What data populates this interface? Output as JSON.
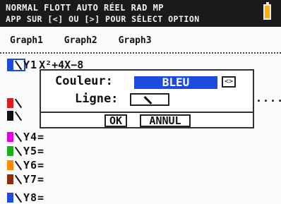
{
  "status_bar": {
    "line1": "NORMAL FLOTT AUTO RÉEL RAD MP",
    "line2": "APP SUR [<] OU [>] POUR SÉLECT OPTION",
    "battery_color": "#ffb300"
  },
  "tabs": [
    "Graph1",
    "Graph2",
    "Graph3"
  ],
  "equation_list": {
    "y1": {
      "label": "Y1",
      "expr_text": "X²+4X−8",
      "color": "#1d4be0"
    },
    "items": [
      {
        "label": "Y4=",
        "color": "#e000e0"
      },
      {
        "label": "Y5=",
        "color": "#1bb11b"
      },
      {
        "label": "Y6=",
        "color": "#ff8a00"
      },
      {
        "label": "Y7=",
        "color": "#8a2b14"
      }
    ],
    "hidden_rows": [
      {
        "color": "#e11b1b"
      },
      {
        "color": "#111111"
      }
    ],
    "y8_partial": {
      "label": "Y8=",
      "color": "#1d4be0"
    }
  },
  "dialog": {
    "color_label": "Couleur:",
    "color_value": "BLEU",
    "line_label": "Ligne:",
    "ok_label": "OK",
    "cancel_label": "ANNUL"
  },
  "right_dots": "...."
}
